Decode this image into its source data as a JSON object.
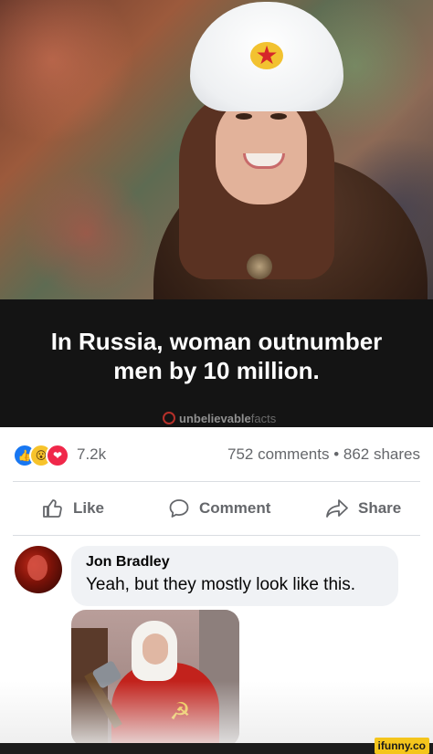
{
  "post": {
    "caption_line1": "In Russia, woman outnumber",
    "caption_line2": "men by 10 million.",
    "watermark_light": "unbelievable",
    "watermark_bold": "facts"
  },
  "stats": {
    "reaction_count": "7.2k",
    "comments_shares": "752 comments • 862 shares"
  },
  "actions": {
    "like_label": "Like",
    "comment_label": "Comment",
    "share_label": "Share"
  },
  "comment": {
    "author": "Jon Bradley",
    "text": "Yeah, but they mostly look like this."
  },
  "branding": {
    "site_watermark": "ifunny.co"
  },
  "colors": {
    "like_blue": "#1877f2",
    "secondary_text": "#65676b",
    "bubble_bg": "#f0f2f5"
  }
}
